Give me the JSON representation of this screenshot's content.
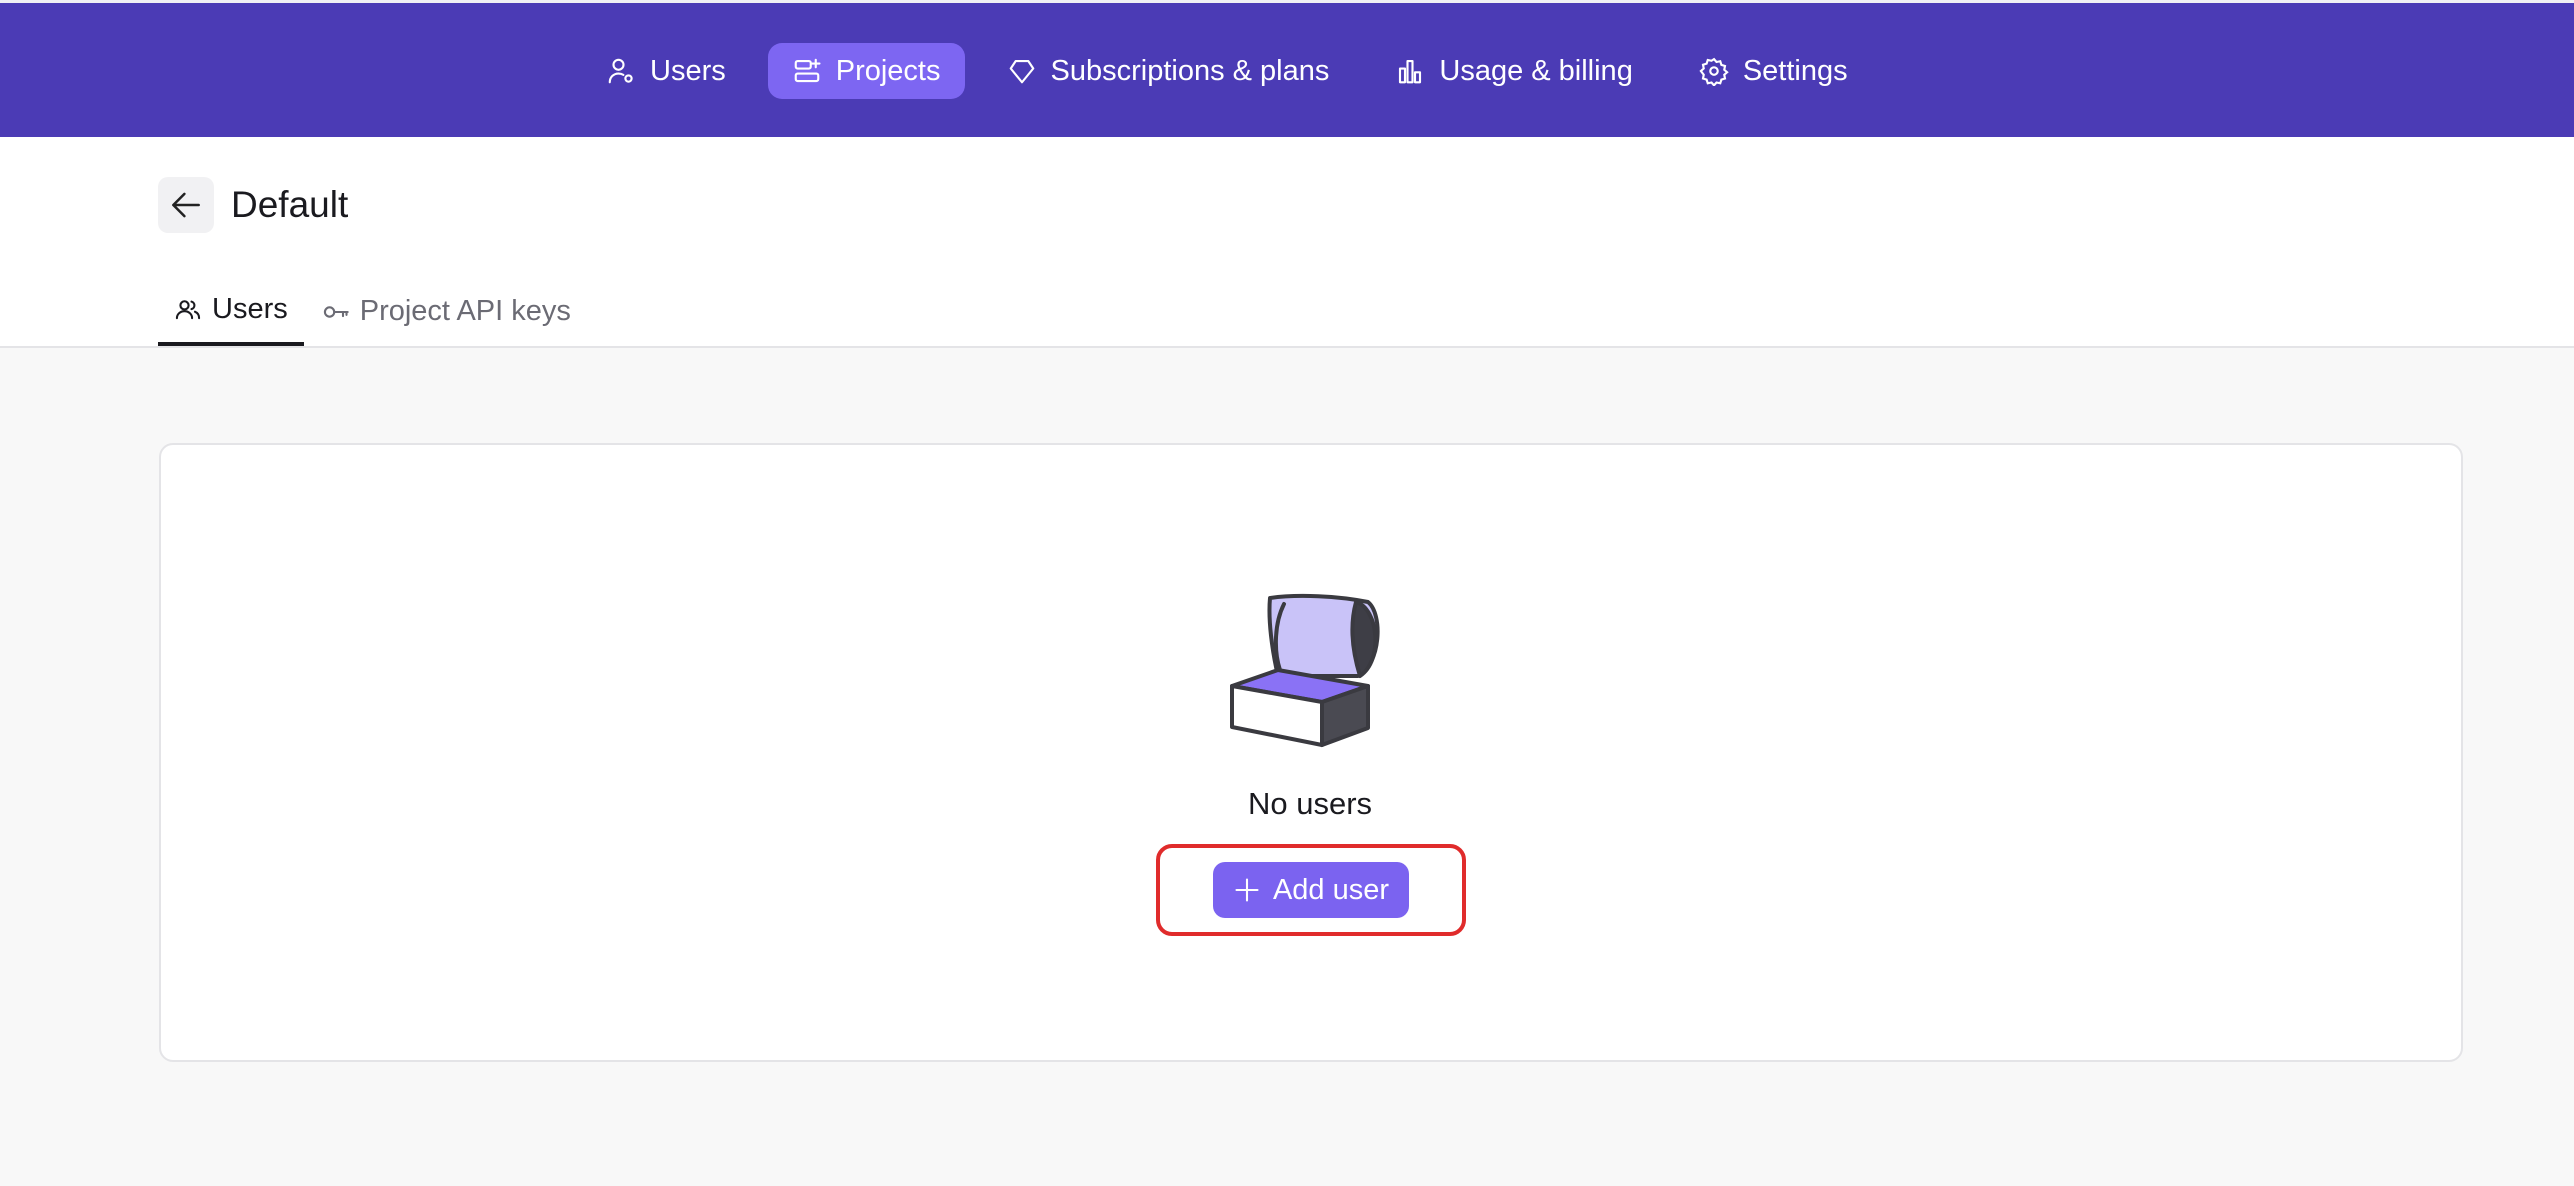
{
  "topnav": {
    "items": [
      {
        "label": "Users",
        "icon": "user-gear-icon",
        "active": false
      },
      {
        "label": "Projects",
        "icon": "projects-icon",
        "active": true
      },
      {
        "label": "Subscriptions & plans",
        "icon": "diamond-icon",
        "active": false
      },
      {
        "label": "Usage & billing",
        "icon": "bar-chart-icon",
        "active": false
      },
      {
        "label": "Settings",
        "icon": "gear-icon",
        "active": false
      }
    ]
  },
  "header": {
    "back_icon": "arrow-left-icon",
    "title": "Default",
    "tabs": [
      {
        "label": "Users",
        "icon": "users-icon",
        "active": true
      },
      {
        "label": "Project API keys",
        "icon": "key-icon",
        "active": false
      }
    ]
  },
  "empty_state": {
    "illustration": "open-chest-illustration",
    "message": "No users",
    "button_label": "Add user",
    "button_icon": "plus-icon"
  },
  "colors": {
    "topbar": "#4b3bb5",
    "active_nav": "#7d66f2",
    "primary_button": "#7b63f0",
    "highlight_border": "#e02b2b"
  }
}
